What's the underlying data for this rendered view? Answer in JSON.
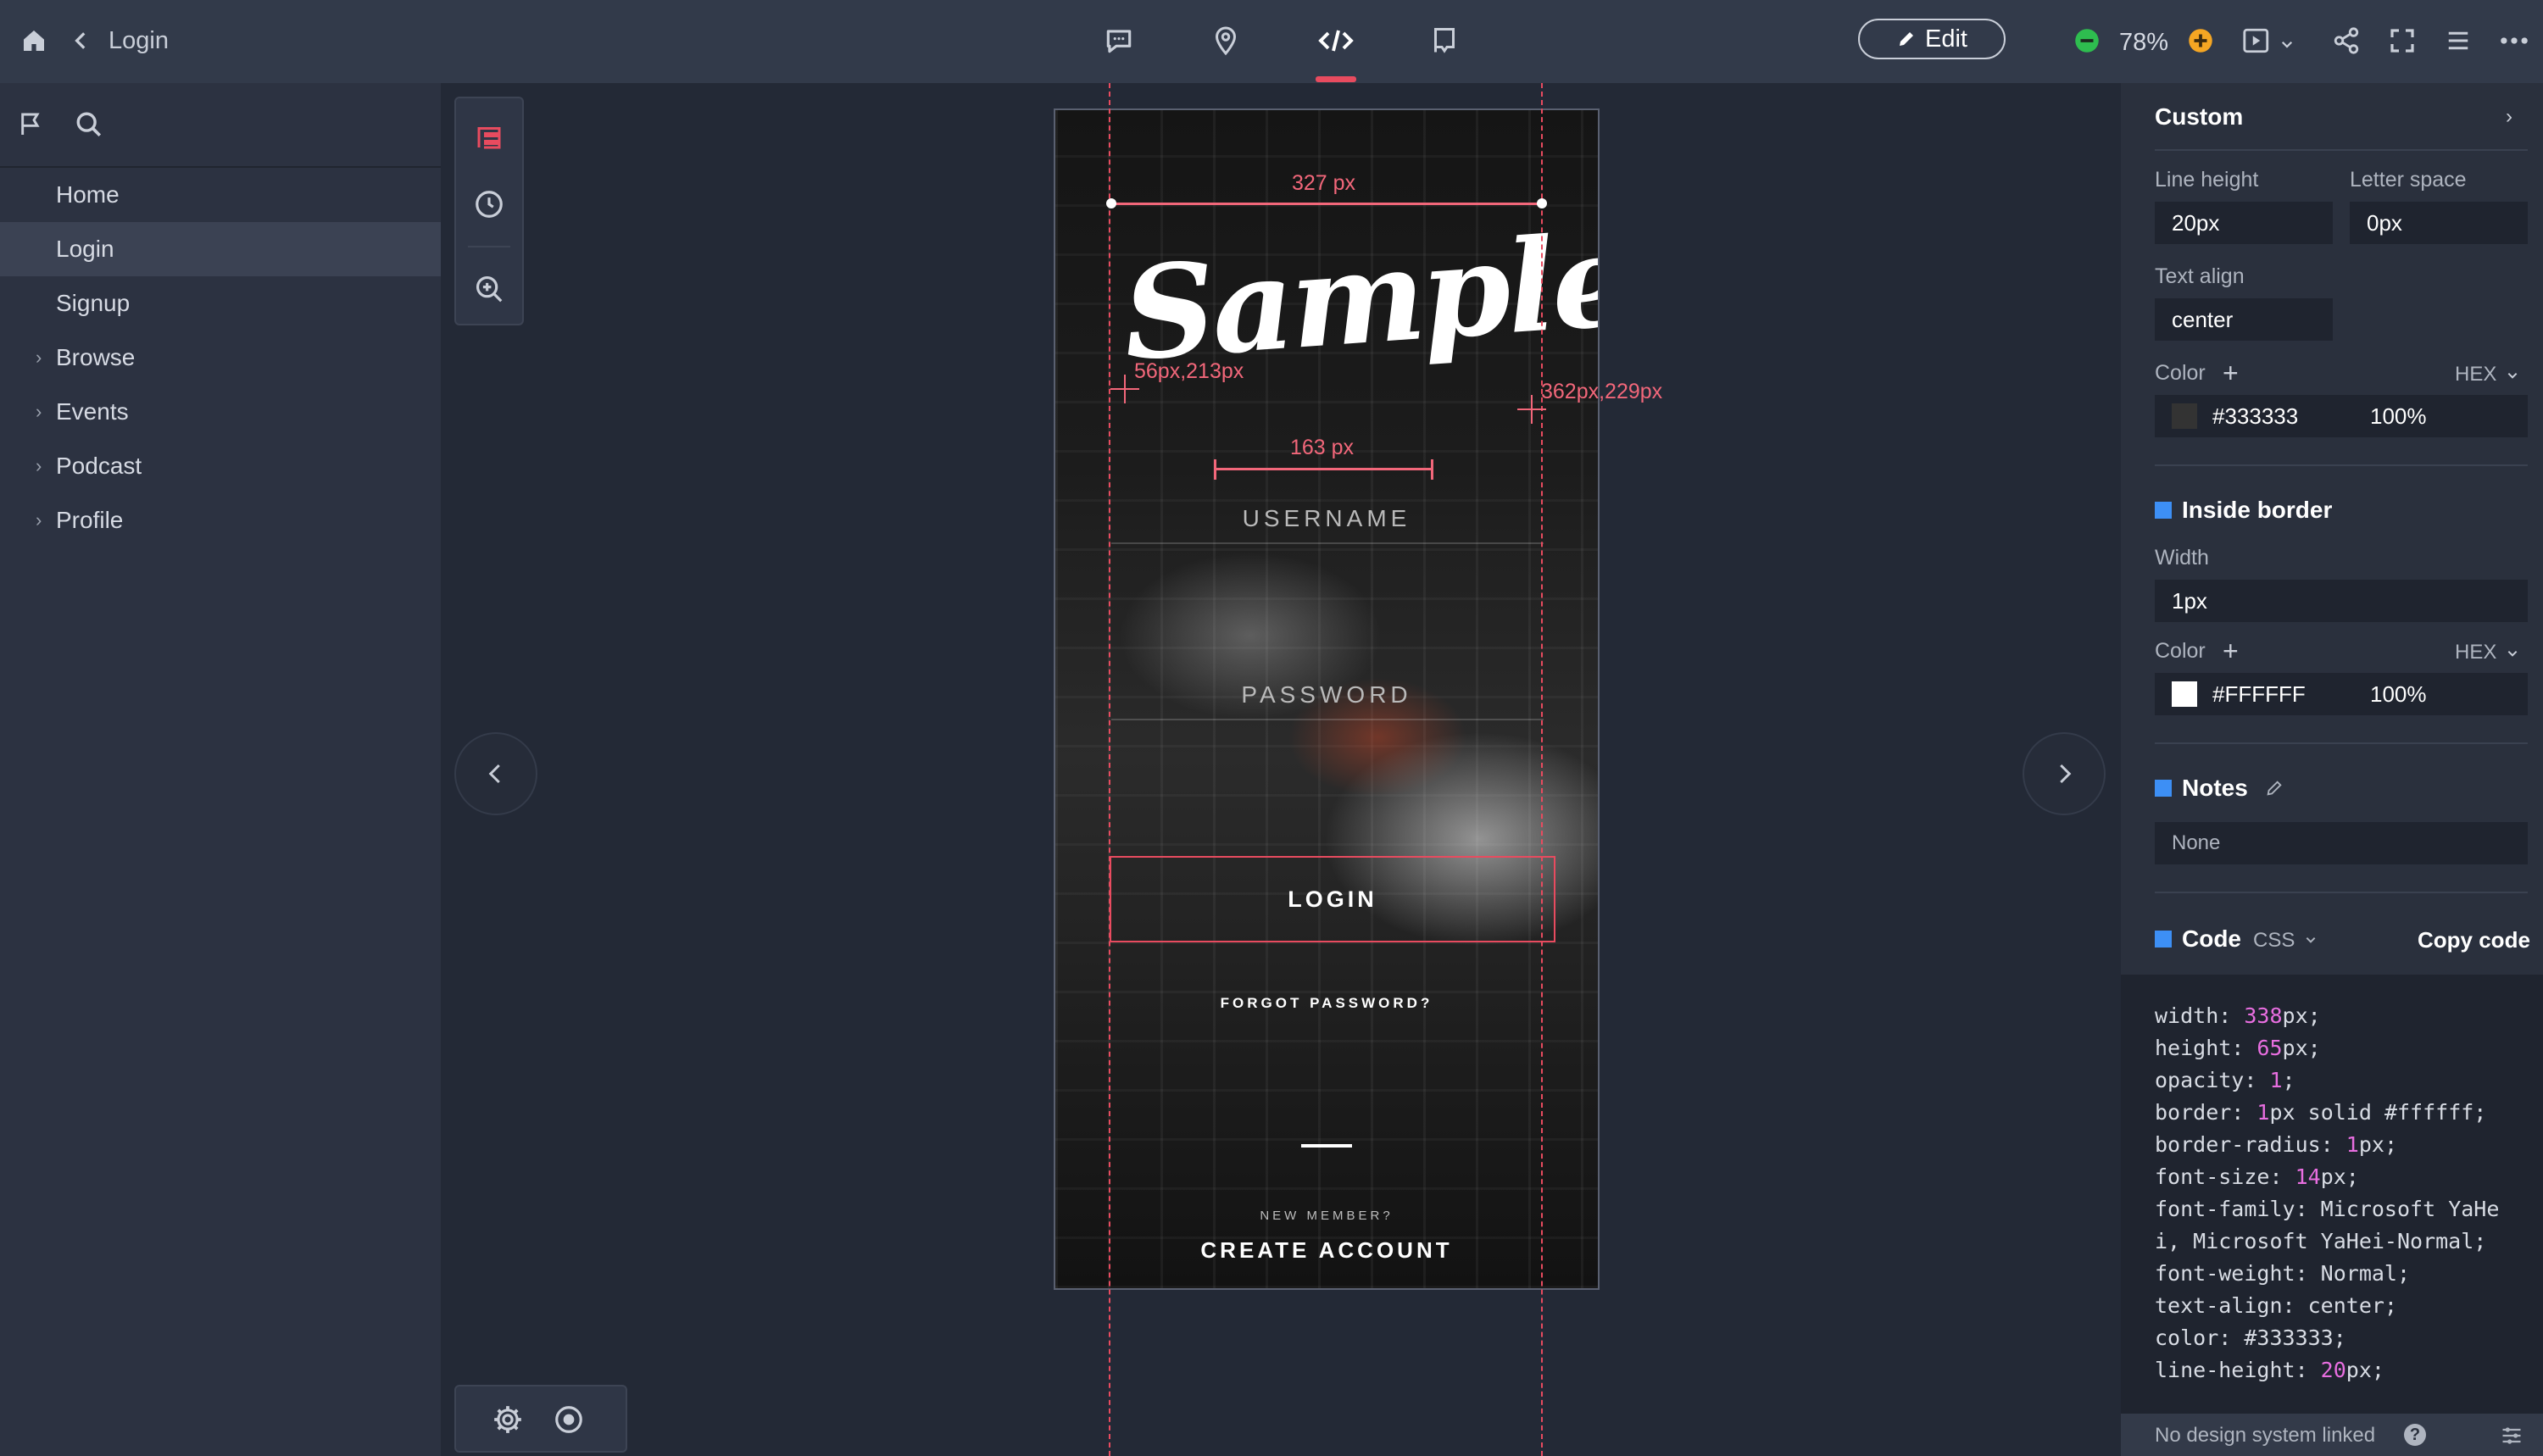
{
  "topbar": {
    "back_label": "Login",
    "edit_label": "Edit",
    "zoom": "78%"
  },
  "sidebar": {
    "items": [
      {
        "label": "Home",
        "expandable": false,
        "active": false
      },
      {
        "label": "Login",
        "expandable": false,
        "active": true
      },
      {
        "label": "Signup",
        "expandable": false,
        "active": false
      },
      {
        "label": "Browse",
        "expandable": true,
        "active": false
      },
      {
        "label": "Events",
        "expandable": true,
        "active": false
      },
      {
        "label": "Podcast",
        "expandable": true,
        "active": false
      },
      {
        "label": "Profile",
        "expandable": true,
        "active": false
      }
    ]
  },
  "artboard": {
    "logo_text": "Sample",
    "username_label": "USERNAME",
    "password_label": "PASSWORD",
    "login_label": "LOGIN",
    "forgot_label": "FORGOT PASSWORD?",
    "new_member_label": "NEW MEMBER?",
    "create_account_label": "CREATE ACCOUNT"
  },
  "measurements": {
    "width_label": "327 px",
    "inner_width_label": "163 px",
    "point_a_label": "56px,213px",
    "point_b_label": "362px,229px"
  },
  "panel": {
    "title": "Custom",
    "line_height_label": "Line height",
    "line_height_value": "20px",
    "letter_space_label": "Letter space",
    "letter_space_value": "0px",
    "text_align_label": "Text align",
    "text_align_value": "center",
    "color_label": "Color",
    "color_mode": "HEX",
    "text_color_hex": "#333333",
    "text_color_opacity": "100%",
    "inside_border_title": "Inside border",
    "width_label": "Width",
    "border_width_value": "1px",
    "border_color_label": "Color",
    "border_color_mode": "HEX",
    "border_color_hex": "#FFFFFF",
    "border_color_opacity": "100%",
    "notes_title": "Notes",
    "notes_value": "None",
    "code_title": "Code",
    "code_lang": "CSS",
    "copy_code_label": "Copy code",
    "code": {
      "width": "338",
      "height": "65",
      "opacity": "1",
      "border_width": "1",
      "border_rest": "px solid #ffffff;",
      "border_radius": "1",
      "font_size": "14",
      "font_family_1": " Microsoft YaHe",
      "font_family_2": "i, Microsoft YaHei-Normal;",
      "font_weight": " Normal;",
      "text_align": " center;",
      "color": " #333333;",
      "line_height": "20"
    },
    "footer_label": "No design system linked"
  },
  "colors": {
    "accent": "#e84b5f",
    "link_blue": "#3d8ff5",
    "zoom_out": "#2ebd4f",
    "zoom_in": "#f5a623",
    "text_color_swatch": "#333333",
    "border_color_swatch": "#FFFFFF"
  }
}
